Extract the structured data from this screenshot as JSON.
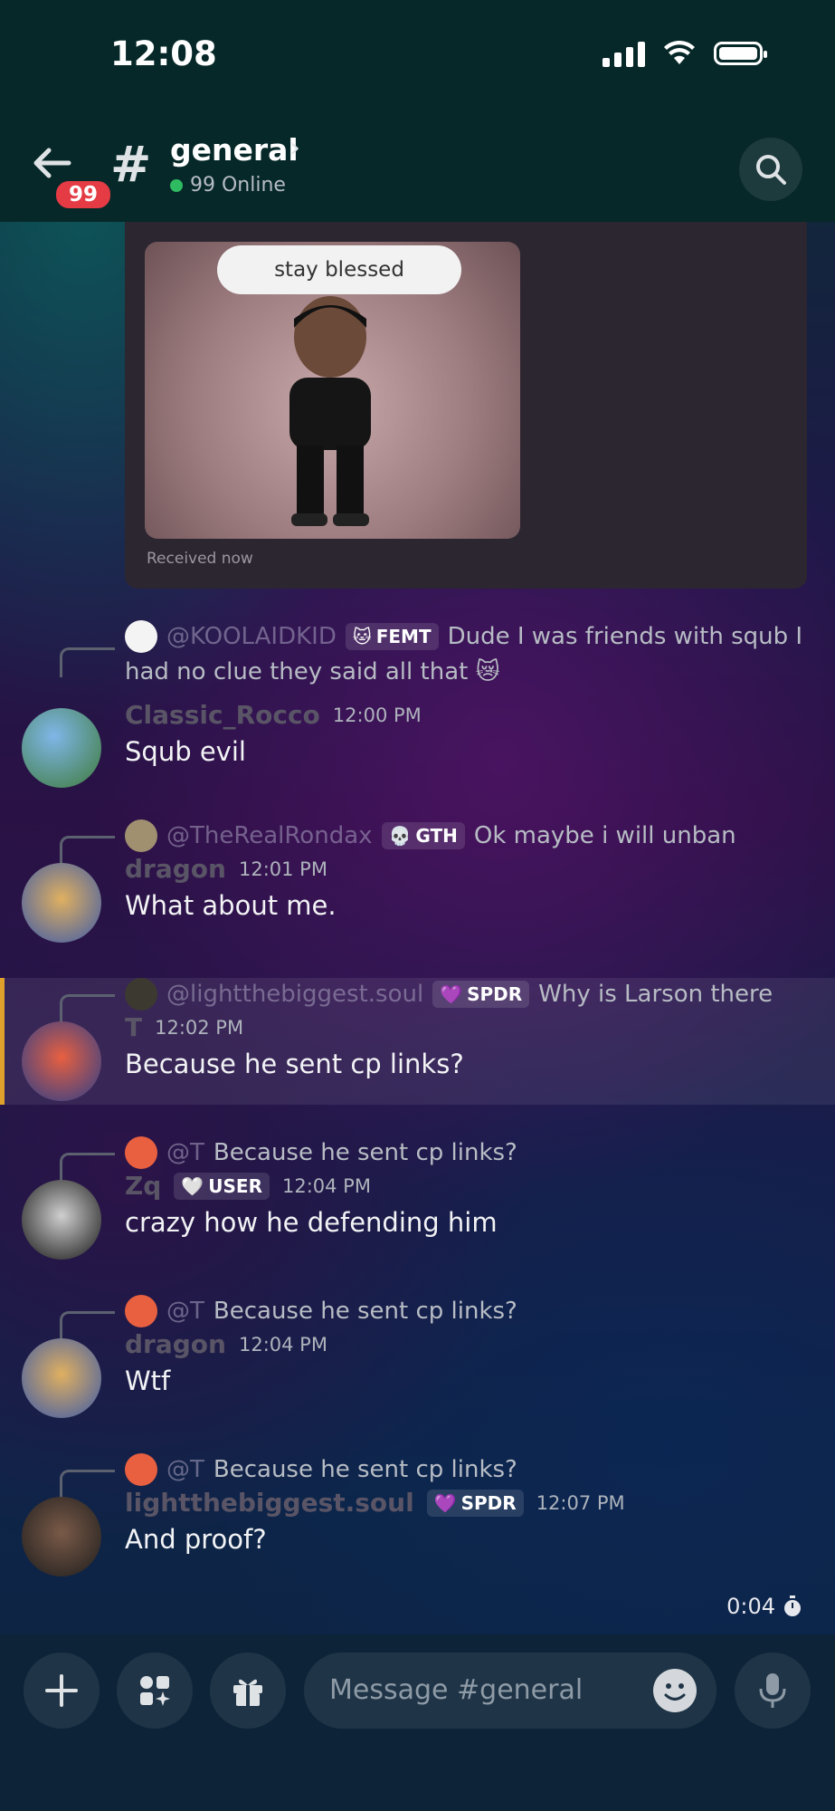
{
  "status": {
    "time": "12:08"
  },
  "header": {
    "unread_count": "99",
    "channel": "general",
    "online": "99 Online"
  },
  "image_card": {
    "caption": "stay blessed",
    "received": "Received now"
  },
  "messages": [
    {
      "reply_name": "@KOOLAIDKID",
      "reply_role": "FEMT",
      "reply_role_icon": "🐱",
      "reply_text": "Dude I was friends with squb I",
      "reply_text2": "had no clue they said all that 😿",
      "author": "Classic_Rocco",
      "time": "12:00 PM",
      "text": "Squb evil"
    },
    {
      "reply_name": "@TheRealRondax",
      "reply_role": "GTH",
      "reply_role_icon": "💀",
      "reply_text": "Ok maybe i will unban",
      "author": "dragon",
      "time": "12:01 PM",
      "text": "What about me."
    },
    {
      "reply_name": "@lightthebiggest.soul",
      "reply_role": "SPDR",
      "reply_role_icon": "💜",
      "reply_text": "Why is Larson there",
      "author": "T",
      "time": "12:02 PM",
      "text": "Because he sent cp links?"
    },
    {
      "reply_name": "@T",
      "reply_text": "Because he sent cp links?",
      "author": "Zq",
      "role": "USER",
      "role_icon": "🤍",
      "time": "12:04 PM",
      "text": "crazy how he defending him"
    },
    {
      "reply_name": "@T",
      "reply_text": "Because he sent cp links?",
      "author": "dragon",
      "time": "12:04 PM",
      "text": "Wtf"
    },
    {
      "reply_name": "@T",
      "reply_text": "Because he sent cp links?",
      "author": "lightthebiggest.soul",
      "role": "SPDR",
      "role_icon": "💜",
      "time": "12:07 PM",
      "text": "And proof?"
    }
  ],
  "timer": "0:04",
  "composer": {
    "placeholder": "Message #general"
  },
  "colors": {
    "accent_online": "#2fbb62",
    "badge": "#e43b45",
    "highlight_bar": "#e0a12c"
  }
}
